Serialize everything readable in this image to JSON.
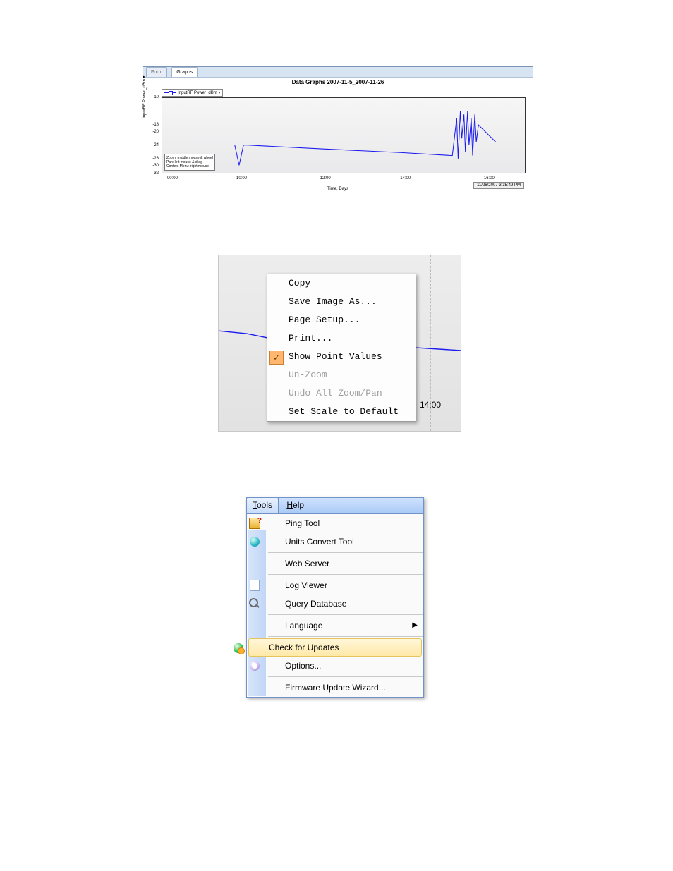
{
  "chart_data": {
    "type": "line",
    "title": "Data Graphs 2007-11-5_2007-11-26",
    "xlabel": "Time, Days",
    "ylabel": "InputRF Power_dBm ▾",
    "legend": "InputRF Power_dBm ▾",
    "x_ticks": [
      "00:00",
      "10:00",
      "12:00",
      "14:00",
      "16:00"
    ],
    "y_ticks": [
      -10,
      -18,
      -20,
      -24,
      -28,
      -30,
      -32
    ],
    "ylim": [
      -32,
      -10
    ],
    "series": [
      {
        "name": "InputRF Power_dBm",
        "x": [
          9.6,
          9.8,
          10.0,
          10.2,
          12.0,
          14.0,
          15.2,
          15.3,
          15.35,
          15.4,
          15.45,
          15.5,
          15.55,
          15.6,
          15.65,
          15.7,
          15.75,
          15.8,
          15.85,
          15.9,
          16.3
        ],
        "y": [
          -24,
          -30,
          -24,
          -24,
          -25,
          -26,
          -27,
          -16,
          -28,
          -14,
          -22,
          -15,
          -26,
          -14,
          -24,
          -16,
          -27,
          -15,
          -23,
          -18,
          -23
        ]
      }
    ],
    "help_lines": [
      "Zoom: middle mouse & wheel",
      "Pan: left mouse & drag",
      "Context Menu: right mouse"
    ],
    "timestamp": "11/26/2007 3:35:49 PM"
  },
  "tabs": {
    "form": "Form",
    "graphs": "Graphs"
  },
  "context_menu": {
    "copy": "Copy",
    "save_image": "Save Image As...",
    "page_setup": "Page Setup...",
    "print": "Print...",
    "show_point_values": "Show Point Values",
    "unzoom": "Un-Zoom",
    "undo_all": "Undo All Zoom/Pan",
    "set_default": "Set Scale to Default",
    "x_tick": "14:00"
  },
  "tools_menu": {
    "bar": {
      "tools": "Tools",
      "help": "Help"
    },
    "items": {
      "ping": "Ping Tool",
      "units": "Units Convert Tool",
      "web": "Web Server",
      "log": "Log Viewer",
      "query": "Query Database",
      "language": "Language",
      "updates": "Check for Updates",
      "options": "Options...",
      "firmware": "Firmware Update Wizard..."
    }
  }
}
